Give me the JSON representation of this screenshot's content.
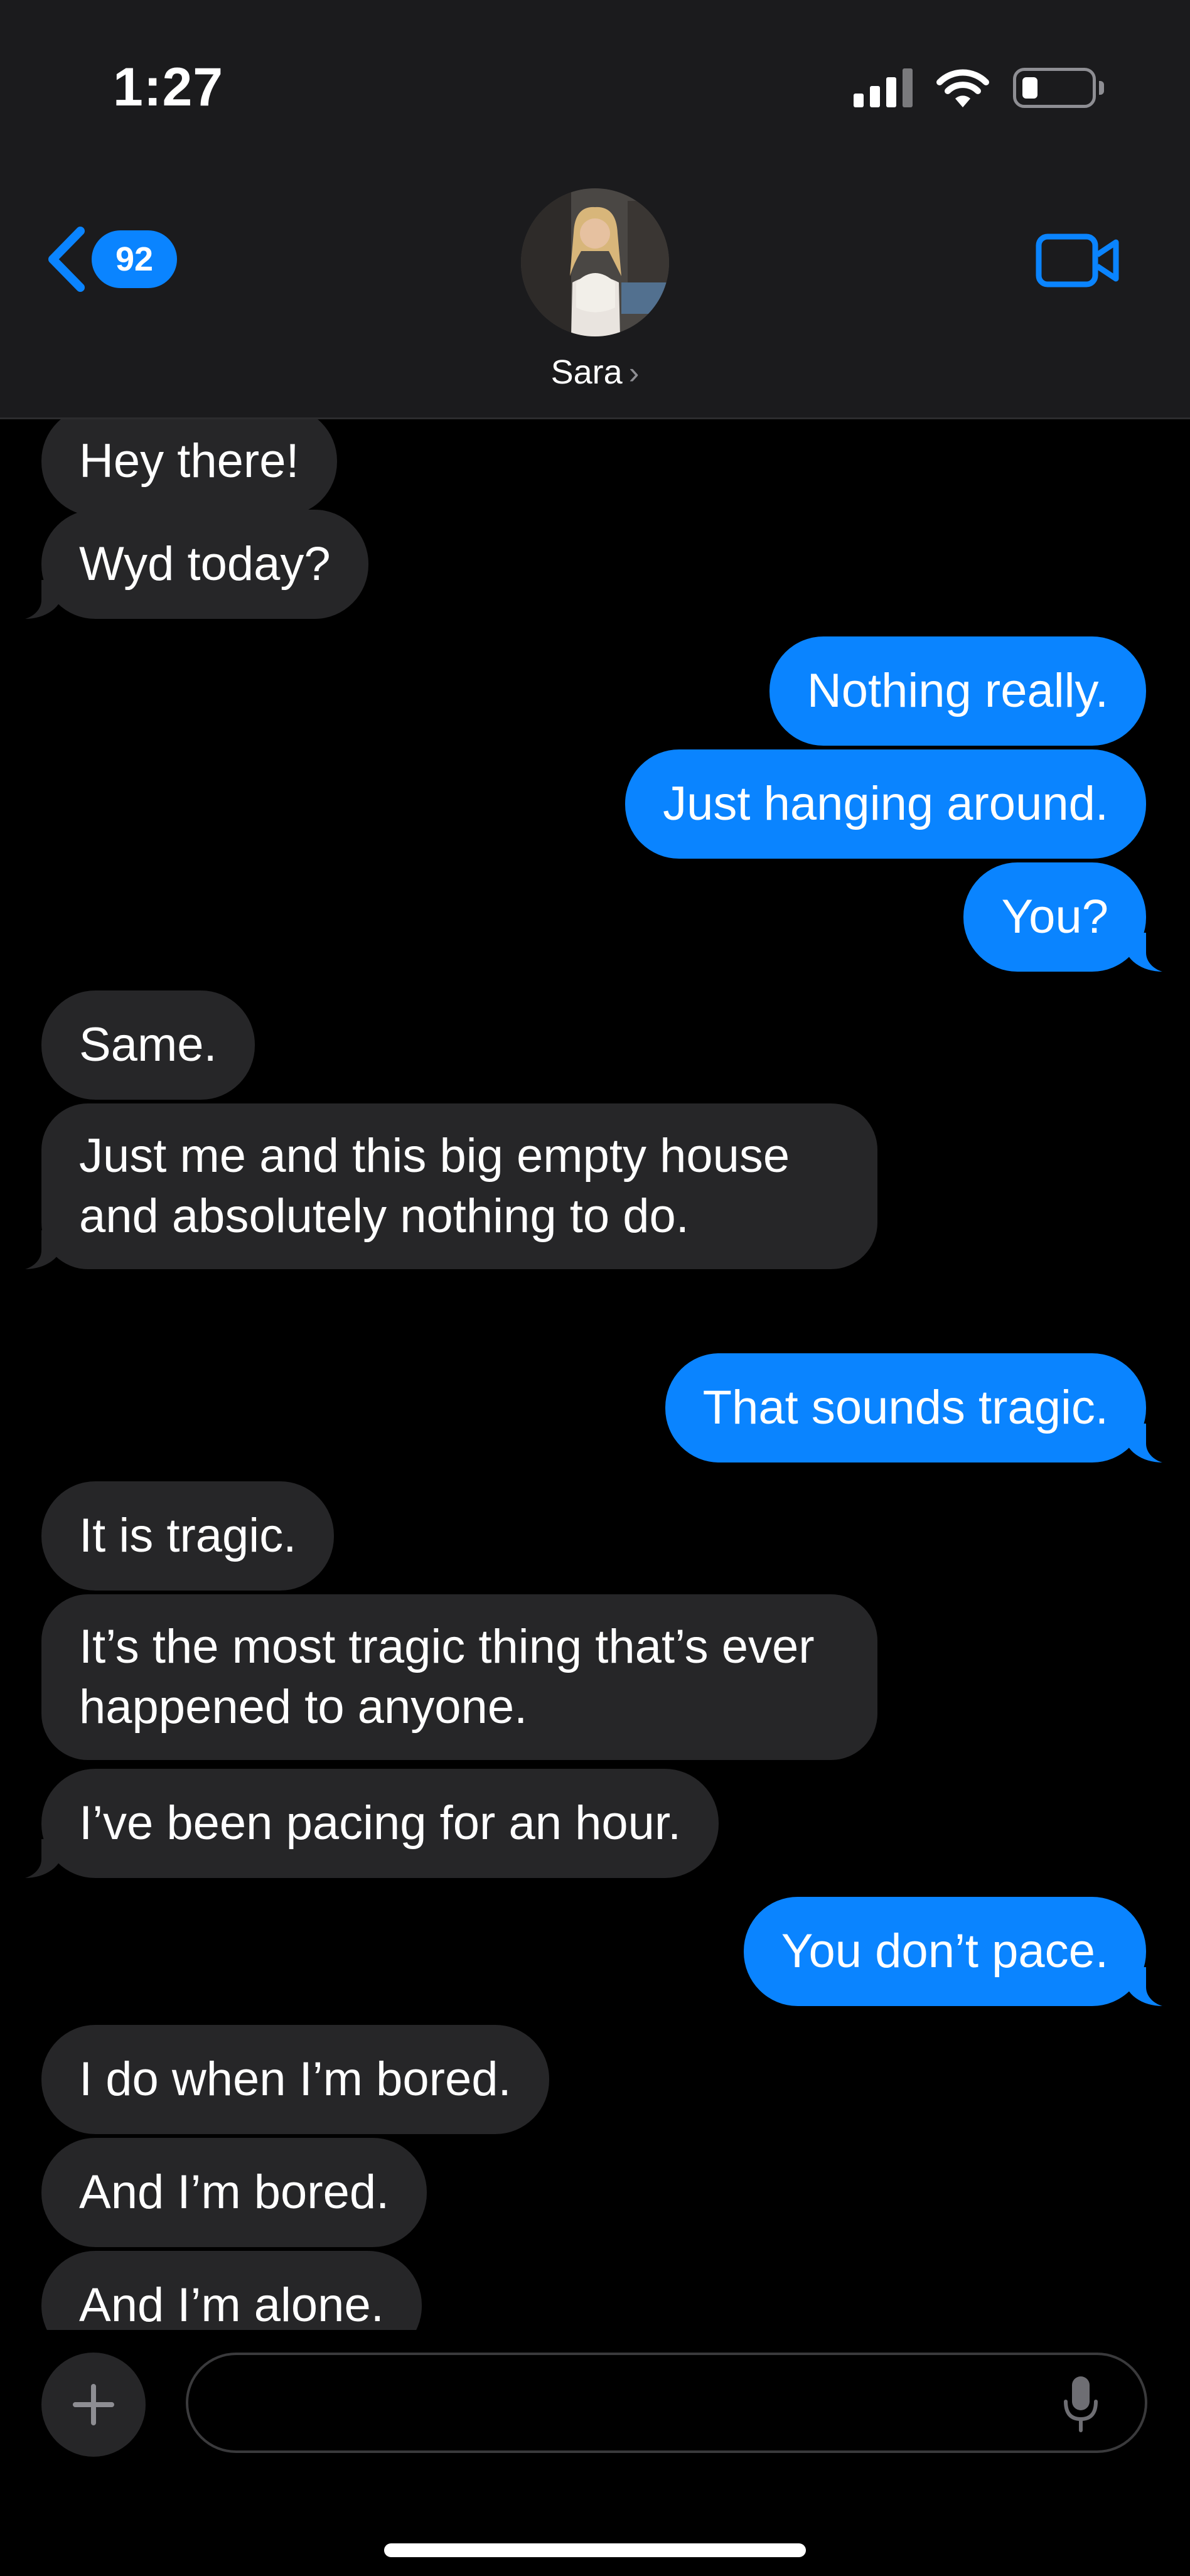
{
  "status_bar": {
    "time": "1:27"
  },
  "header": {
    "back_badge": "92",
    "contact_name": "Sara",
    "contact_chevron": "›"
  },
  "messages": [
    {
      "from": "them",
      "text": "Hey there!"
    },
    {
      "from": "them",
      "text": "Wyd today?"
    },
    {
      "from": "me",
      "text": "Nothing really."
    },
    {
      "from": "me",
      "text": "Just hanging around."
    },
    {
      "from": "me",
      "text": "You?"
    },
    {
      "from": "them",
      "text": "Same."
    },
    {
      "from": "them",
      "text": "Just me and this big empty house and absolutely nothing to do."
    },
    {
      "from": "me",
      "text": "That sounds tragic."
    },
    {
      "from": "them",
      "text": "It is tragic."
    },
    {
      "from": "them",
      "text": "It’s the most tragic thing that’s ever happened to anyone."
    },
    {
      "from": "them",
      "text": "I’ve been pacing for an hour."
    },
    {
      "from": "me",
      "text": "You don’t pace."
    },
    {
      "from": "them",
      "text": "I do when I’m bored."
    },
    {
      "from": "them",
      "text": "And I’m bored."
    },
    {
      "from": "them",
      "text": "And I’m alone."
    }
  ],
  "composer": {
    "value": "",
    "placeholder": ""
  },
  "colors": {
    "accent": "#0a84ff",
    "incoming_bubble": "#262628",
    "background": "#000000",
    "header": "#1b1b1d"
  },
  "icons": [
    "signal-icon",
    "wifi-icon",
    "battery-icon",
    "chevron-left-icon",
    "video-call-icon",
    "plus-icon",
    "microphone-icon"
  ]
}
